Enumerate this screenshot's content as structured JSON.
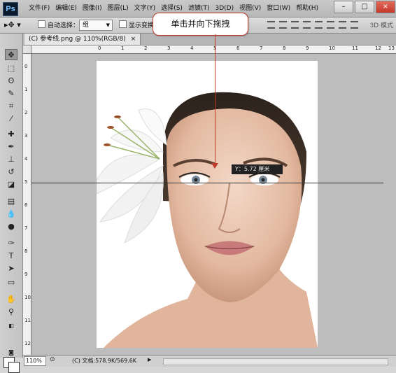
{
  "app": {
    "logo": "Ps"
  },
  "menu": [
    {
      "label": "文件(F)"
    },
    {
      "label": "编辑(E)"
    },
    {
      "label": "图像(I)"
    },
    {
      "label": "图层(L)"
    },
    {
      "label": "文字(Y)"
    },
    {
      "label": "选择(S)"
    },
    {
      "label": "滤镜(T)"
    },
    {
      "label": "3D(D)"
    },
    {
      "label": "视图(V)"
    },
    {
      "label": "窗口(W)"
    },
    {
      "label": "帮助(H)"
    }
  ],
  "window_controls": {
    "minimize": "–",
    "maximize": "□",
    "close": "×"
  },
  "options": {
    "auto_select_label": "自动选择：",
    "auto_select_value": "组",
    "show_transform_label": "显示变换",
    "mode_3d": "3D 模式"
  },
  "document": {
    "tab_title": "(C) 参考线.png @ 110%(RGB/8)",
    "close_glyph": "×"
  },
  "rulers": {
    "h_ticks": [
      "0",
      "1",
      "2",
      "3",
      "4",
      "5",
      "6",
      "7",
      "8",
      "9",
      "10",
      "11",
      "12",
      "13"
    ],
    "v_ticks": [
      "0",
      "1",
      "2",
      "3",
      "4",
      "5",
      "6",
      "7",
      "8",
      "9",
      "10",
      "11",
      "12"
    ]
  },
  "callout": {
    "text": "单击并向下拖拽"
  },
  "tooltip": {
    "text": "Y：5.72 厘米"
  },
  "status": {
    "zoom": "110%",
    "doc_info": "(C) 文档:578.9K/569.6K"
  },
  "colors": {
    "accent": "#c0392b",
    "guide": "#333333"
  }
}
